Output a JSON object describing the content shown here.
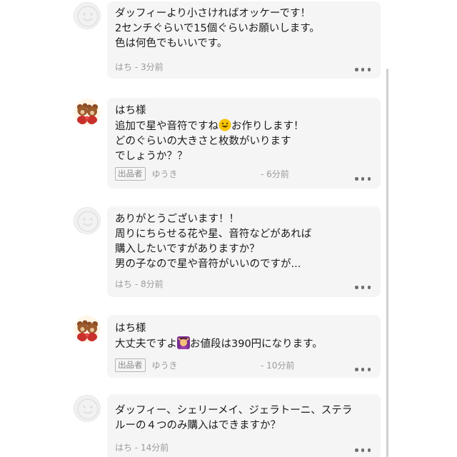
{
  "comments": [
    {
      "user": "はち",
      "lines": [
        "ダッフィーより小さければオッケーです！",
        "2センチぐらいで15個ぐらいお願いします。",
        "色は何色でもいいです。"
      ],
      "time": "3分前",
      "author_label": "はち - 3分前"
    },
    {
      "greeting": "はち様",
      "line1_before": "追加で星や音符ですね",
      "emoji_1": "smiling-face-emoji",
      "line1_after": "お作りします！",
      "lines_rest": [
        "どのぐらいの大きさと枚数がいります",
        "でしょうか？？"
      ],
      "badge": "出品者",
      "seller_name": "ゆうき",
      "time": "- 6分前"
    },
    {
      "user": "はち",
      "lines": [
        "ありがとうございます！！",
        "周りにちらせる花や星、音符などがあれば",
        "購入したいですがありますか？",
        "男の子なので星や音符がいいのですが..."
      ],
      "author_label": "はち - 8分前"
    },
    {
      "greeting": "はち様",
      "line_before": "大丈夫ですよ",
      "emoji_2": "woman-gesturing-ok-emoji",
      "line_after": "お値段は390円になります。",
      "badge": "出品者",
      "seller_name": "ゆうき",
      "time": "- 10分前"
    },
    {
      "lines": [
        "ダッフィー、シェリーメイ、ジェラトーニ、ステラ",
        "ルーの４つのみ購入はできますか？"
      ],
      "author_label": "はち - 14分前"
    }
  ],
  "icons": {
    "more": "more-dots-icon",
    "default_avatar": "default-avatar-icon",
    "seller_avatar": "teddy-bear-avatar-icon"
  },
  "colors": {
    "bubble": "#f5f5f5",
    "text": "#1a1a1a",
    "meta": "#9a9a9a"
  }
}
